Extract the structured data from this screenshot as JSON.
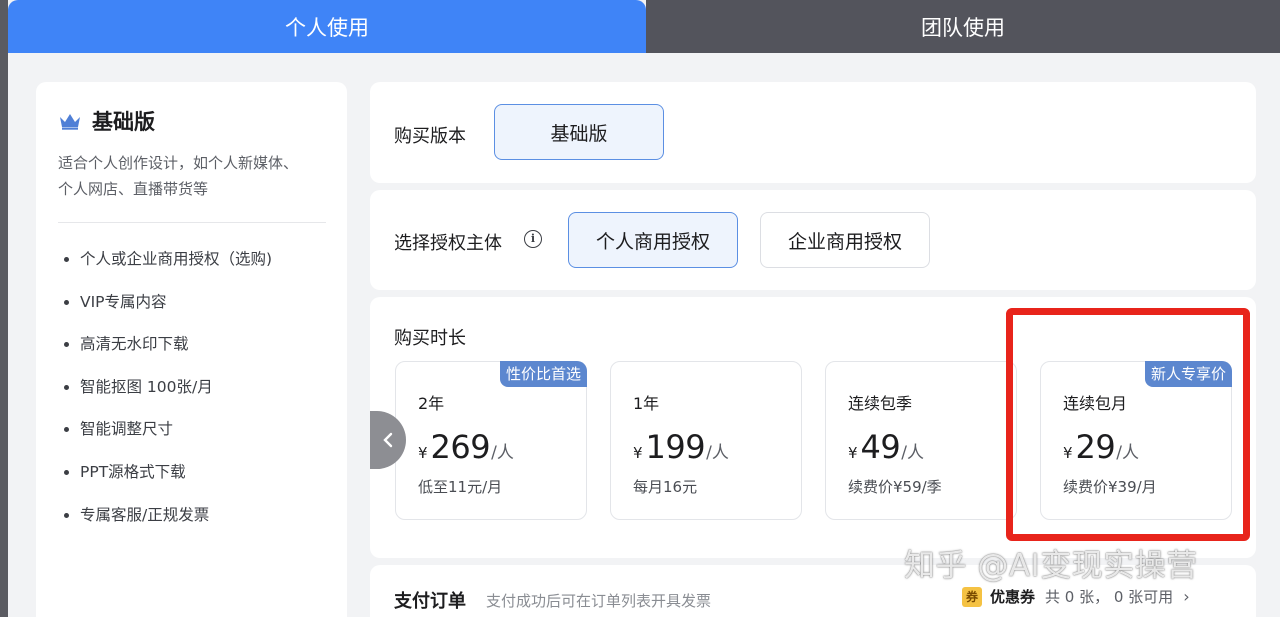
{
  "tabs": {
    "personal": "个人使用",
    "team": "团队使用"
  },
  "plan": {
    "title": "基础版",
    "description": "适合个人创作设计，如个人新媒体、个人网店、直播带货等",
    "features": [
      "个人或企业商用授权（选购)",
      "VIP专属内容",
      "高清无水印下载",
      "智能抠图 100张/月",
      "智能调整尺寸",
      "PPT源格式下载",
      "专属客服/正规发票"
    ]
  },
  "version": {
    "label": "购买版本",
    "selected": "基础版"
  },
  "license": {
    "label": "选择授权主体",
    "info_icon": "i",
    "options": [
      "个人商用授权",
      "企业商用授权"
    ],
    "selected": "个人商用授权"
  },
  "duration": {
    "label": "购买时长",
    "cards": [
      {
        "name": "2年",
        "currency": "¥",
        "amount": "269",
        "unit": "/人",
        "sub": "低至11元/月",
        "badge": "性价比首选"
      },
      {
        "name": "1年",
        "currency": "¥",
        "amount": "199",
        "unit": "/人",
        "sub": "每月16元",
        "badge": ""
      },
      {
        "name": "连续包季",
        "currency": "¥",
        "amount": "49",
        "unit": "/人",
        "sub": "续费价¥59/季",
        "badge": ""
      },
      {
        "name": "连续包月",
        "currency": "¥",
        "amount": "29",
        "unit": "/人",
        "sub": "续费价¥39/月",
        "badge": "新人专享价"
      }
    ]
  },
  "payment": {
    "title": "支付订单",
    "note": "支付成功后可在订单列表开具发票",
    "coupon_icon": "券",
    "coupon_label": "优惠券",
    "coupon_count": "共 0 张， 0 张可用",
    "chevron": "›"
  },
  "watermark": "知乎 @AI变现实操营",
  "colors": {
    "accent": "#3f84f7",
    "badge": "#5c87cf",
    "highlight": "#e8241b"
  }
}
